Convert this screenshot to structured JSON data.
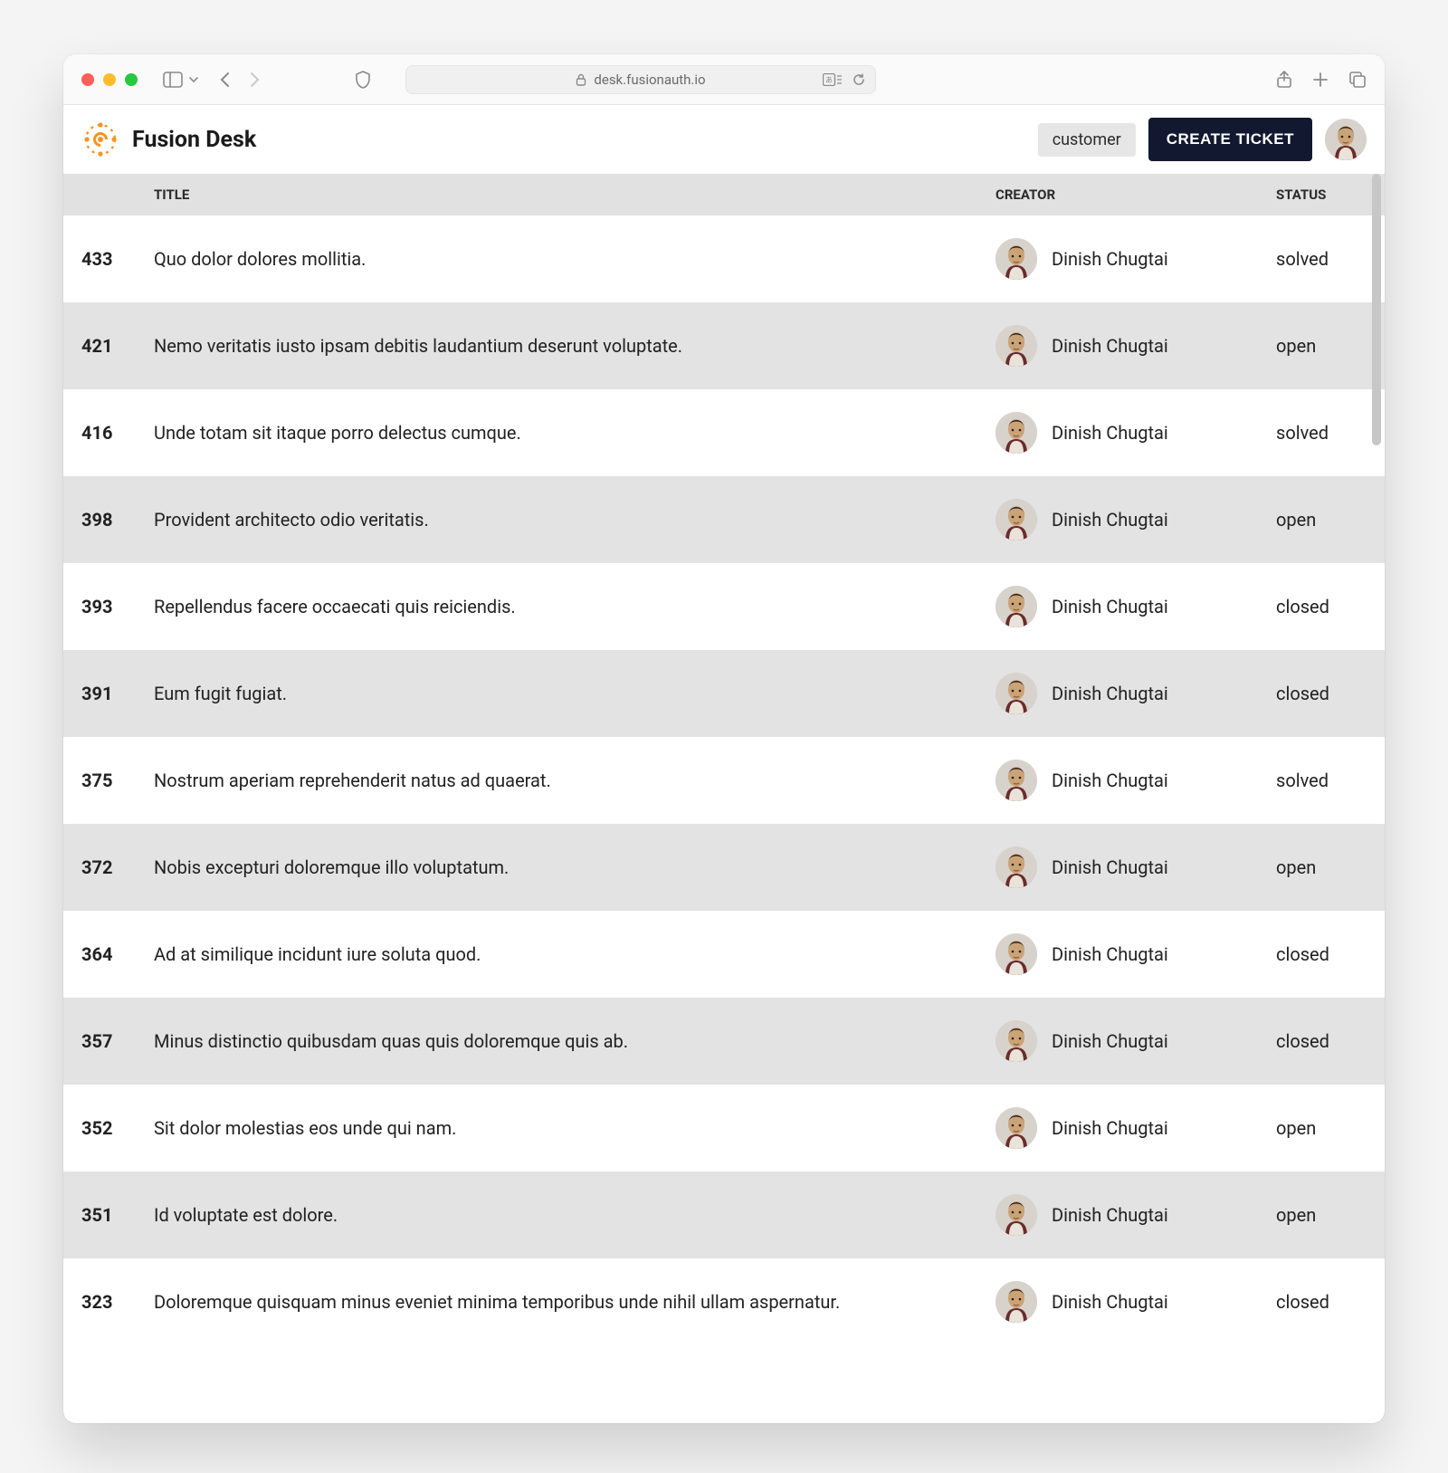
{
  "browser": {
    "url": "desk.fusionauth.io"
  },
  "app": {
    "title": "Fusion Desk",
    "role_badge": "customer",
    "create_button": "CREATE TICKET"
  },
  "table": {
    "headers": {
      "id": "",
      "title": "TITLE",
      "creator": "CREATOR",
      "status": "STATUS"
    },
    "rows": [
      {
        "id": "433",
        "title": "Quo dolor dolores mollitia.",
        "creator": "Dinish Chugtai",
        "status": "solved"
      },
      {
        "id": "421",
        "title": "Nemo veritatis iusto ipsam debitis laudantium deserunt voluptate.",
        "creator": "Dinish Chugtai",
        "status": "open"
      },
      {
        "id": "416",
        "title": "Unde totam sit itaque porro delectus cumque.",
        "creator": "Dinish Chugtai",
        "status": "solved"
      },
      {
        "id": "398",
        "title": "Provident architecto odio veritatis.",
        "creator": "Dinish Chugtai",
        "status": "open"
      },
      {
        "id": "393",
        "title": "Repellendus facere occaecati quis reiciendis.",
        "creator": "Dinish Chugtai",
        "status": "closed"
      },
      {
        "id": "391",
        "title": "Eum fugit fugiat.",
        "creator": "Dinish Chugtai",
        "status": "closed"
      },
      {
        "id": "375",
        "title": "Nostrum aperiam reprehenderit natus ad quaerat.",
        "creator": "Dinish Chugtai",
        "status": "solved"
      },
      {
        "id": "372",
        "title": "Nobis excepturi doloremque illo voluptatum.",
        "creator": "Dinish Chugtai",
        "status": "open"
      },
      {
        "id": "364",
        "title": "Ad at similique incidunt iure soluta quod.",
        "creator": "Dinish Chugtai",
        "status": "closed"
      },
      {
        "id": "357",
        "title": "Minus distinctio quibusdam quas quis doloremque quis ab.",
        "creator": "Dinish Chugtai",
        "status": "closed"
      },
      {
        "id": "352",
        "title": "Sit dolor molestias eos unde qui nam.",
        "creator": "Dinish Chugtai",
        "status": "open"
      },
      {
        "id": "351",
        "title": "Id voluptate est dolore.",
        "creator": "Dinish Chugtai",
        "status": "open"
      },
      {
        "id": "323",
        "title": "Doloremque quisquam minus eveniet minima temporibus unde nihil ullam aspernatur.",
        "creator": "Dinish Chugtai",
        "status": "closed"
      }
    ]
  }
}
